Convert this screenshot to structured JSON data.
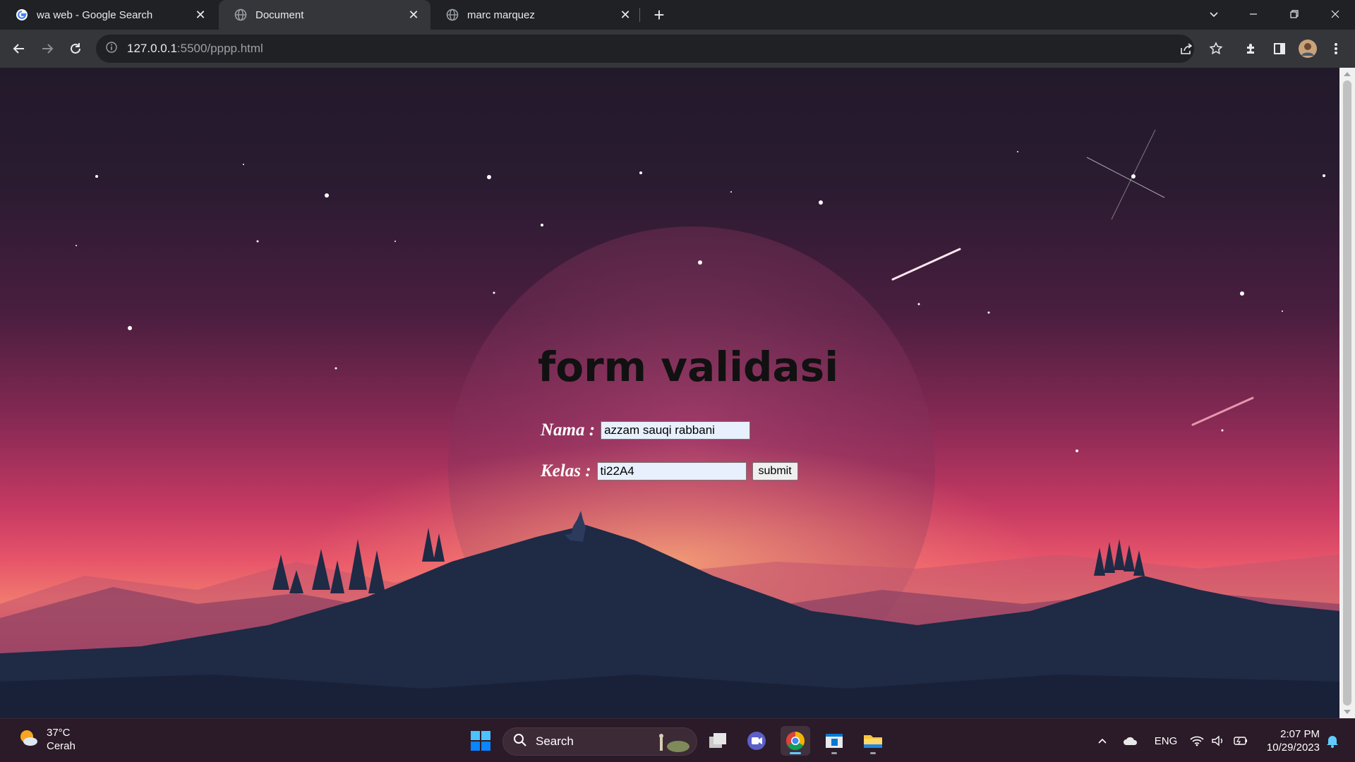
{
  "browser": {
    "tabs": [
      {
        "title": "wa web - Google Search",
        "icon": "google-icon",
        "active": false
      },
      {
        "title": "Document",
        "icon": "globe-icon",
        "active": true
      },
      {
        "title": "marc marquez",
        "icon": "globe-icon",
        "active": false
      }
    ],
    "url_host": "127.0.0.1",
    "url_path": ":5500/pppp.html"
  },
  "page": {
    "title": "form validasi",
    "nama_label": "Nama :",
    "nama_value": "azzam sauqi rabbani",
    "kelas_label": "Kelas :",
    "kelas_value": "ti22A4",
    "submit_label": "submit"
  },
  "taskbar": {
    "weather_temp": "37°C",
    "weather_desc": "Cerah",
    "search_label": "Search",
    "language": "ENG",
    "time": "2:07 PM",
    "date": "10/29/2023"
  },
  "colors": {
    "accent": "#60cdff",
    "sky_top": "#221a2b",
    "sky_glow": "#f07a6e",
    "mountain": "#1f2a45"
  }
}
